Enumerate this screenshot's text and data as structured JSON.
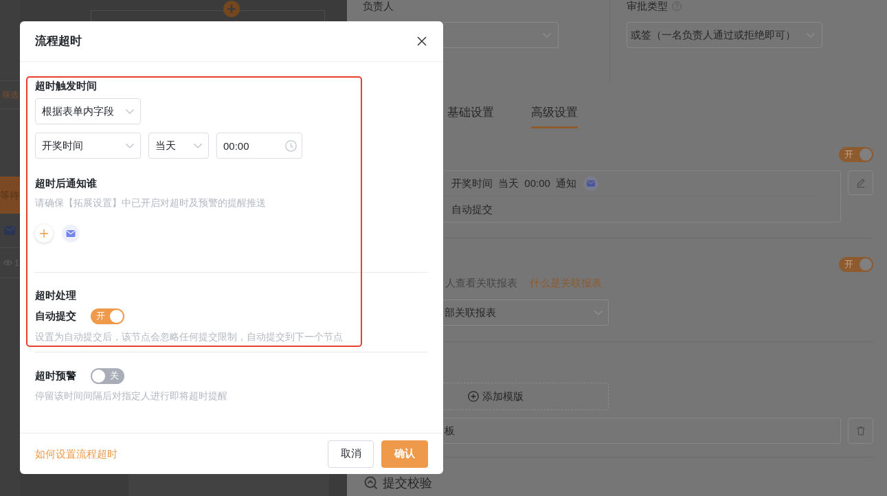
{
  "canvas": {
    "filter_label": "筛选",
    "status_label": "等待",
    "view_count": "1"
  },
  "panel": {
    "assignee": {
      "label": "负责人"
    },
    "approval_type": {
      "label": "审批类型",
      "value": "或签（一名负责人通过或拒绝即可）"
    },
    "tabs": [
      {
        "label": "基础设置",
        "selected": false
      },
      {
        "label": "高级设置",
        "selected": true
      }
    ],
    "timeout": {
      "on": true,
      "toggle_text": "开",
      "condition": "开奖时间 当天 00:00 通知",
      "action": "自动提交"
    },
    "related": {
      "on": true,
      "toggle_text": "开",
      "hint": "人查看关联报表",
      "help_link": "什么是关联报表",
      "value": "部关联报表"
    },
    "templates": {
      "add_label": "添加模版",
      "items": [
        {
          "name": "板"
        }
      ]
    },
    "next_section": "提交校验"
  },
  "modal": {
    "title": "流程超时",
    "highlight_frame": true,
    "trigger": {
      "label": "超时触发时间",
      "mode": "根据表单内字段",
      "field": "开奖时间",
      "day": "当天",
      "time": "00:00"
    },
    "notify": {
      "label": "超时后通知谁",
      "hint": "请确保【拓展设置】中已开启对超时及预警的提醒推送",
      "recipients": [
        {
          "kind": "email"
        }
      ]
    },
    "handling": {
      "label": "超时处理",
      "auto_submit": {
        "label": "自动提交",
        "on": true,
        "toggle_text": "开",
        "hint": "设置为自动提交后，该节点会忽略任何提交限制，自动提交到下一个节点"
      }
    },
    "warning": {
      "label": "超时预警",
      "on": false,
      "toggle_text": "关",
      "hint": "停留该时间间隔后对指定人进行即将超时提醒"
    },
    "footer": {
      "help_link": "如何设置流程超时",
      "buttons": [
        {
          "label": "取消",
          "kind": "secondary"
        },
        {
          "label": "确认",
          "kind": "primary"
        }
      ]
    }
  }
}
